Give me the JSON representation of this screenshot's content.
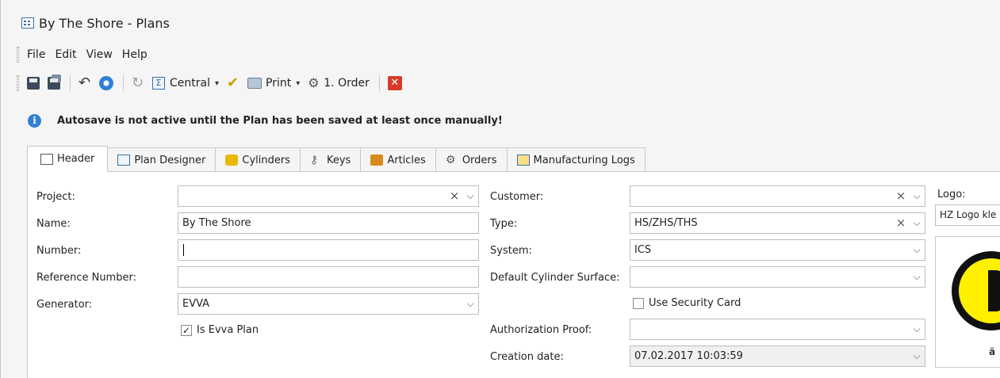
{
  "window": {
    "title": "By The Shore - Plans"
  },
  "menu": [
    "File",
    "Edit",
    "View",
    "Help"
  ],
  "toolbar": {
    "central_label": "Central",
    "print_label": "Print",
    "order_label": "1. Order"
  },
  "info": {
    "message": "Autosave is not active until the Plan has been saved at least once manually!"
  },
  "tabs": [
    "Header",
    "Plan Designer",
    "Cylinders",
    "Keys",
    "Articles",
    "Orders",
    "Manufacturing Logs"
  ],
  "form": {
    "project": {
      "label": "Project:",
      "value": ""
    },
    "name": {
      "label": "Name:",
      "value": "By The Shore"
    },
    "number": {
      "label": "Number:",
      "value": ""
    },
    "reference_number": {
      "label": "Reference Number:",
      "value": ""
    },
    "generator": {
      "label": "Generator:",
      "value": "EVVA"
    },
    "is_evva_plan": {
      "label": "Is Evva Plan",
      "checked": true
    },
    "customer": {
      "label": "Customer:",
      "value": ""
    },
    "type": {
      "label": "Type:",
      "value": "HS/ZHS/THS"
    },
    "system": {
      "label": "System:",
      "value": "ICS"
    },
    "default_cylinder_surface": {
      "label": "Default Cylinder Surface:",
      "value": ""
    },
    "use_security_card": {
      "label": "Use Security Card",
      "checked": false
    },
    "authorization_proof": {
      "label": "Authorization Proof:",
      "value": ""
    },
    "creation_date": {
      "label": "Creation date:",
      "value": "07.02.2017 10:03:59"
    },
    "logo": {
      "label": "Logo:",
      "value": "HZ Logo kle"
    }
  },
  "glyphs": {
    "clear": "×",
    "dropdown": "⌵",
    "check": "✓",
    "caret": "▾"
  },
  "icons": [
    "save-icon",
    "save-all-icon",
    "undo-icon",
    "refresh-icon",
    "sigma-icon",
    "check-icon",
    "print-icon",
    "order-icon",
    "close-icon",
    "info-icon"
  ],
  "colors": {
    "accent_blue": "#2f7fd6",
    "close_red": "#d93b2a",
    "logo_yellow": "#fff000"
  }
}
